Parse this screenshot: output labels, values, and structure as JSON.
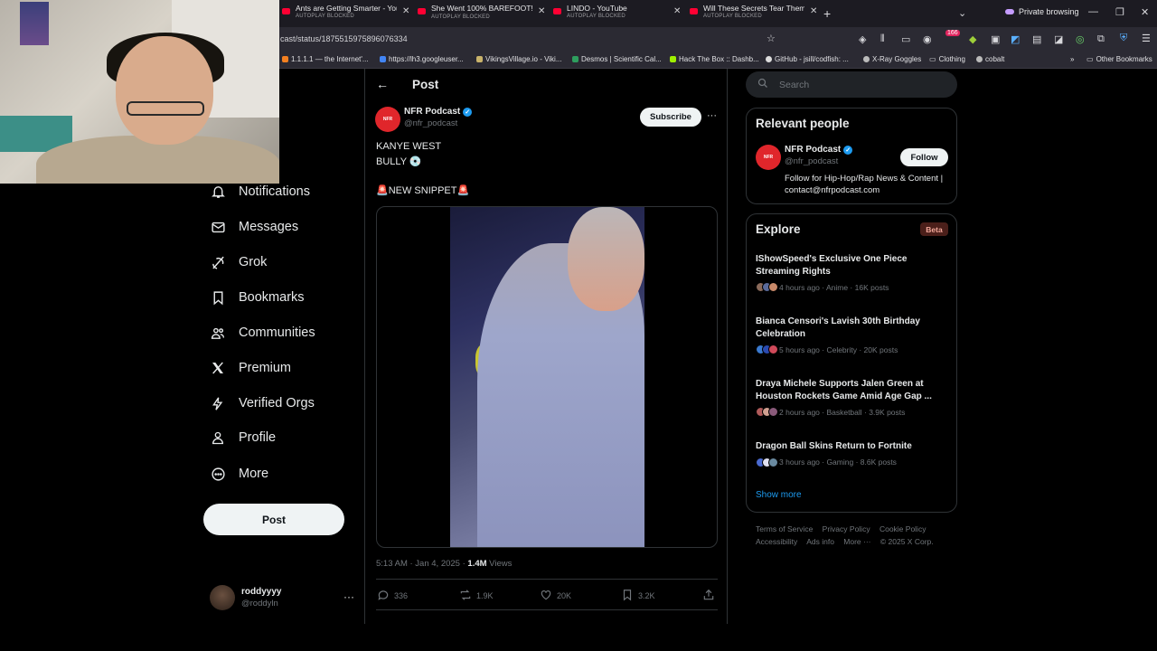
{
  "browser": {
    "tabs": [
      {
        "title": "Ants are Getting Smarter - You Tu",
        "status": "AUTOPLAY BLOCKED"
      },
      {
        "title": "She Went 100% BAREFOOT!😳",
        "status": "AUTOPLAY BLOCKED"
      },
      {
        "title": "LINDO - YouTube",
        "status": "AUTOPLAY BLOCKED"
      },
      {
        "title": "Will These Secrets Tear Them Ap",
        "status": "AUTOPLAY BLOCKED"
      }
    ],
    "private_label": "Private browsing",
    "url": "cast/status/1875515975896076334",
    "badge_count": "166",
    "bookmarks": [
      "1.1.1.1 — the Internet'...",
      "https://lh3.googleuser...",
      "VikingsVillage.io - Viki...",
      "Desmos | Scientific Cal...",
      "Hack The Box :: Dashb...",
      "GitHub - jsill/codfish: ...",
      "X-Ray Goggles",
      "Clothing",
      "cobalt",
      "Other Bookmarks"
    ]
  },
  "nav": {
    "items": [
      {
        "label": "Notifications",
        "icon": "bell-icon",
        "badge": "10"
      },
      {
        "label": "Messages",
        "icon": "envelope-icon"
      },
      {
        "label": "Grok",
        "icon": "grok-icon"
      },
      {
        "label": "Bookmarks",
        "icon": "bookmark-icon"
      },
      {
        "label": "Communities",
        "icon": "people-icon"
      },
      {
        "label": "Premium",
        "icon": "x-logo-icon"
      },
      {
        "label": "Verified Orgs",
        "icon": "lightning-icon"
      },
      {
        "label": "Profile",
        "icon": "person-icon"
      },
      {
        "label": "More",
        "icon": "more-circle-icon"
      }
    ],
    "post_button": "Post",
    "account": {
      "name": "roddyyyy",
      "handle": "@roddyln"
    }
  },
  "post": {
    "header_title": "Post",
    "author": {
      "name": "NFR Podcast",
      "handle": "@nfr_podcast",
      "avatar_text": "NFR"
    },
    "subscribe_label": "Subscribe",
    "lines": [
      "KANYE WEST",
      "BULLY 💿",
      "",
      "🚨NEW SNIPPET🚨"
    ],
    "time": "5:13 AM · Jan 4, 2025 · ",
    "views_count": "1.4M",
    "views_label": " Views",
    "stats": {
      "replies": "336",
      "reposts": "1.9K",
      "likes": "20K",
      "bookmarks": "3.2K"
    }
  },
  "sidebar": {
    "search_placeholder": "Search",
    "relevant": {
      "title": "Relevant people",
      "name": "NFR Podcast",
      "handle": "@nfr_podcast",
      "follow_label": "Follow",
      "bio": "Follow for Hip-Hop/Rap News & Content | contact@nfrpodcast.com"
    },
    "explore": {
      "title": "Explore",
      "beta": "Beta",
      "trends": [
        {
          "title": "IShowSpeed's Exclusive One Piece Streaming Rights",
          "meta": "4 hours ago · Anime · 16K posts"
        },
        {
          "title": "Bianca Censori's Lavish 30th Birthday Celebration",
          "meta": "5 hours ago · Celebrity · 20K posts"
        },
        {
          "title": "Draya Michele Supports Jalen Green at Houston Rockets Game Amid Age Gap ...",
          "meta": "2 hours ago · Basketball · 3.9K posts"
        },
        {
          "title": "Dragon Ball Skins Return to Fortnite",
          "meta": "3 hours ago · Gaming · 8.6K posts"
        }
      ],
      "show_more": "Show more"
    },
    "footer": {
      "links": [
        "Terms of Service",
        "Privacy Policy",
        "Cookie Policy",
        "Accessibility",
        "Ads info",
        "More ···"
      ],
      "copyright": "© 2025 X Corp."
    }
  },
  "colors": {
    "accent": "#1d9bf0",
    "background": "#000000",
    "border": "#2f3336",
    "muted": "#71767b"
  }
}
